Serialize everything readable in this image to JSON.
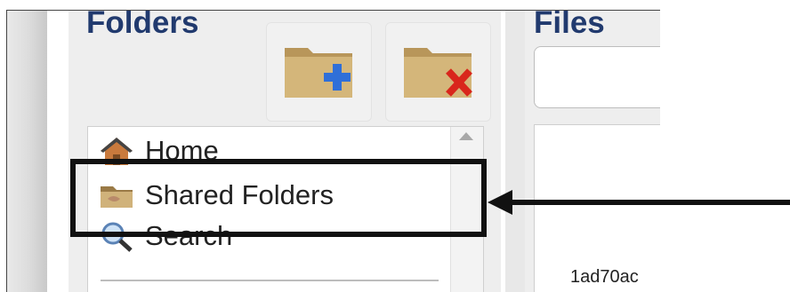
{
  "folders_panel": {
    "title": "Folders",
    "toolbar": {
      "new_folder_icon": "folder-add-icon",
      "delete_folder_icon": "folder-delete-icon"
    },
    "tree": [
      {
        "label": "Home",
        "icon": "home-icon"
      },
      {
        "label": "Shared Folders",
        "icon": "shared-folder-icon"
      },
      {
        "label": "Search",
        "icon": "search-icon"
      }
    ]
  },
  "files_panel": {
    "title": "Files",
    "list": [
      "1ad70ac"
    ]
  },
  "colors": {
    "title": "#213a6e",
    "folder": "#c8a86a",
    "plus": "#2f6fd8",
    "cross": "#d9261c"
  }
}
